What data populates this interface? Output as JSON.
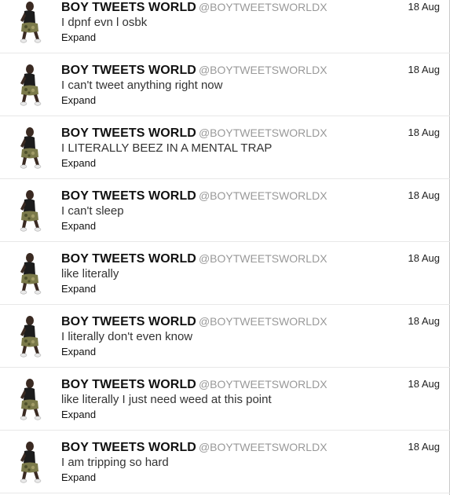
{
  "tweets": [
    {
      "name": "BOY TWEETS WORLD",
      "handle": "@BOYTWEETSWORLDX",
      "time": "18 Aug",
      "text": "I dpnf evn l osbk",
      "expand": "Expand"
    },
    {
      "name": "BOY TWEETS WORLD",
      "handle": "@BOYTWEETSWORLDX",
      "time": "18 Aug",
      "text": "I can't tweet anything right now",
      "expand": "Expand"
    },
    {
      "name": "BOY TWEETS WORLD",
      "handle": "@BOYTWEETSWORLDX",
      "time": "18 Aug",
      "text": "I LITERALLY BEEZ IN A MENTAL TRAP",
      "expand": "Expand"
    },
    {
      "name": "BOY TWEETS WORLD",
      "handle": "@BOYTWEETSWORLDX",
      "time": "18 Aug",
      "text": "I can't sleep",
      "expand": "Expand"
    },
    {
      "name": "BOY TWEETS WORLD",
      "handle": "@BOYTWEETSWORLDX",
      "time": "18 Aug",
      "text": "like literally",
      "expand": "Expand"
    },
    {
      "name": "BOY TWEETS WORLD",
      "handle": "@BOYTWEETSWORLDX",
      "time": "18 Aug",
      "text": "I literally don't even know",
      "expand": "Expand"
    },
    {
      "name": "BOY TWEETS WORLD",
      "handle": "@BOYTWEETSWORLDX",
      "time": "18 Aug",
      "text": "like literally I just need weed at this point",
      "expand": "Expand"
    },
    {
      "name": "BOY TWEETS WORLD",
      "handle": "@BOYTWEETSWORLDX",
      "time": "18 Aug",
      "text": "I am tripping so hard",
      "expand": "Expand"
    }
  ],
  "colors": {
    "name": "#111111",
    "handle": "#999999",
    "divider": "#e8e8e8"
  },
  "icons": {
    "avatar": "crouching-person-avatar"
  }
}
